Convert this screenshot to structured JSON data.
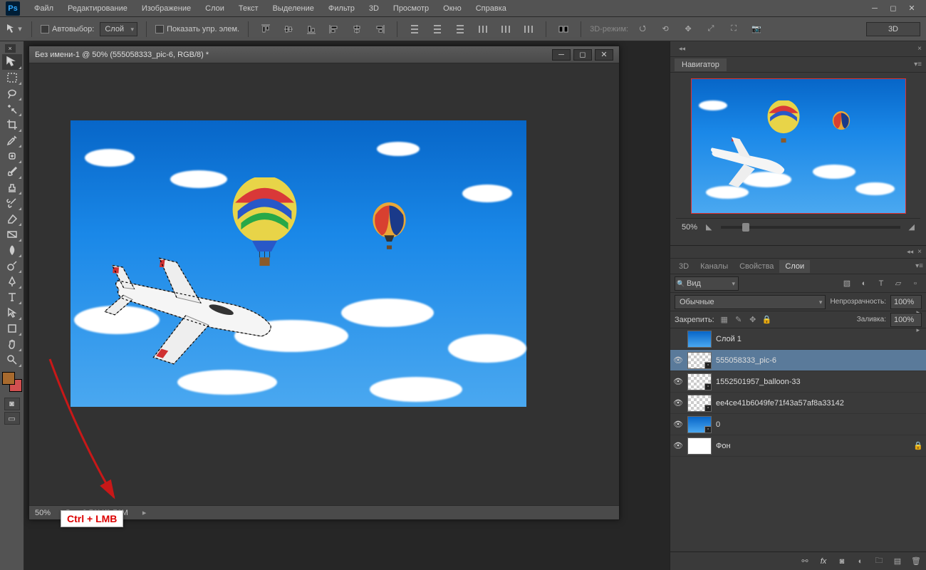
{
  "menu": {
    "items": [
      "Файл",
      "Редактирование",
      "Изображение",
      "Слои",
      "Текст",
      "Выделение",
      "Фильтр",
      "3D",
      "Просмотр",
      "Окно",
      "Справка"
    ]
  },
  "options": {
    "auto_select": "Автовыбор:",
    "layer_dd": "Слой",
    "show_controls": "Показать упр. элем.",
    "mode_3d": "3D-режим:",
    "workspace": "3D"
  },
  "document": {
    "title": "Без имени-1 @ 50% (555058333_pic-6, RGB/8) *",
    "zoom": "50%",
    "docsize": "Док: 2,70M/9,76M",
    "tab_x": "×"
  },
  "navigator": {
    "title": "Навигатор",
    "zoom": "50%"
  },
  "layers_panel": {
    "tabs": [
      "3D",
      "Каналы",
      "Свойства",
      "Слои"
    ],
    "filter_kind": "Вид",
    "blend_mode": "Обычные",
    "opacity_label": "Непрозрачность:",
    "opacity_value": "100%",
    "lock_label": "Закрепить:",
    "fill_label": "Заливка:",
    "fill_value": "100%",
    "layers": [
      {
        "name": "Слой 1",
        "visible": false,
        "thumb": "sky",
        "selected": false,
        "smart": false,
        "locked": false
      },
      {
        "name": "555058333_pic-6",
        "visible": true,
        "thumb": "checker",
        "selected": true,
        "smart": true,
        "locked": false
      },
      {
        "name": "1552501957_balloon-33",
        "visible": true,
        "thumb": "checker",
        "selected": false,
        "smart": true,
        "locked": false
      },
      {
        "name": "ee4ce41b6049fe71f43a57af8a33142",
        "visible": true,
        "thumb": "checker",
        "selected": false,
        "smart": true,
        "locked": false
      },
      {
        "name": "0",
        "visible": true,
        "thumb": "sky",
        "selected": false,
        "smart": true,
        "locked": false
      },
      {
        "name": "Фон",
        "visible": true,
        "thumb": "white",
        "selected": false,
        "smart": false,
        "locked": true
      }
    ]
  },
  "annotation": {
    "tooltip": "Ctrl + LMB"
  }
}
